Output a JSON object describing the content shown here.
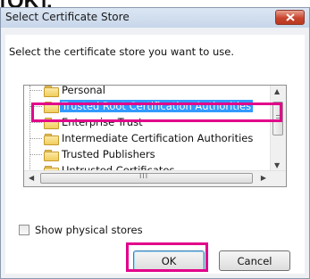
{
  "cropped_caption": "[OK].",
  "window": {
    "title": "Select Certificate Store"
  },
  "prompt": "Select the certificate store you want to use.",
  "tree": {
    "items": [
      {
        "label": "Personal",
        "selected": false
      },
      {
        "label": "Trusted Root Certification Authorities",
        "selected": true
      },
      {
        "label": "Enterprise Trust",
        "selected": false
      },
      {
        "label": "Intermediate Certification Authorities",
        "selected": false
      },
      {
        "label": "Trusted Publishers",
        "selected": false
      },
      {
        "label": "Untrusted Certificates",
        "selected": false
      }
    ]
  },
  "checkbox": {
    "label": "Show physical stores",
    "checked": false
  },
  "buttons": {
    "ok": "OK",
    "cancel": "Cancel"
  },
  "colors": {
    "highlight": "#e2008a",
    "selection": "#3399ff"
  }
}
